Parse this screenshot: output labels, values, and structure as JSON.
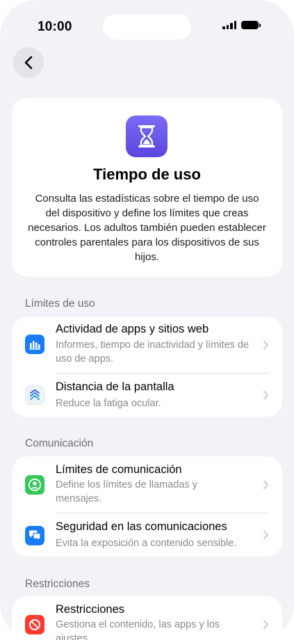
{
  "status": {
    "time": "10:00"
  },
  "hero": {
    "title": "Tiempo de uso",
    "description": "Consulta las estadísticas sobre el tiempo de uso del dispositivo y define los límites que creas necesarios. Los adultos también pueden establecer controles parentales para los dispositivos de sus hijos."
  },
  "sections": [
    {
      "label": "Límites de uso",
      "items": [
        {
          "title": "Actividad de apps y sitios web",
          "subtitle": "Informes, tiempo de inactividad y límites de uso de apps.",
          "icon": "bar-chart-icon",
          "color": "#1a7cf5"
        },
        {
          "title": "Distancia de la pantalla",
          "subtitle": "Reduce la fatiga ocular.",
          "icon": "chevrons-up-icon",
          "color": "#eef3f8"
        }
      ]
    },
    {
      "label": "Comunicación",
      "items": [
        {
          "title": "Límites de comunicación",
          "subtitle": "Define los límites de llamadas y mensajes.",
          "icon": "person-circle-icon",
          "color": "#34c759"
        },
        {
          "title": "Seguridad en las comunicaciones",
          "subtitle": "Evita la exposición a contenido sensible.",
          "icon": "chat-bubbles-icon",
          "color": "#1a7cf5"
        }
      ]
    },
    {
      "label": "Restricciones",
      "items": [
        {
          "title": "Restricciones",
          "subtitle": "Gestiona el contenido, las apps y los ajustes.",
          "icon": "prohibited-icon",
          "color": "#ff3b30"
        }
      ]
    }
  ]
}
